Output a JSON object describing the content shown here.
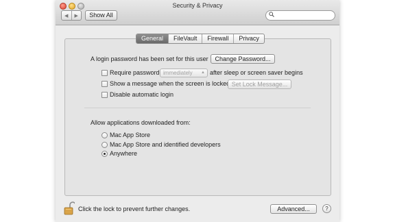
{
  "window": {
    "title": "Security & Privacy",
    "show_all_label": "Show All",
    "search_placeholder": ""
  },
  "tabs": [
    {
      "label": "General",
      "active": true
    },
    {
      "label": "FileVault",
      "active": false
    },
    {
      "label": "Firewall",
      "active": false
    },
    {
      "label": "Privacy",
      "active": false
    }
  ],
  "general": {
    "login_password_text": "A login password has been set for this user",
    "change_password_label": "Change Password...",
    "require_password_label": "Require password",
    "require_password_value": "immediately",
    "require_password_suffix": "after sleep or screen saver begins",
    "show_message_label": "Show a message when the screen is locked",
    "set_lock_message_label": "Set Lock Message...",
    "disable_auto_login_label": "Disable automatic login"
  },
  "downloads": {
    "heading": "Allow applications downloaded from:",
    "options": [
      {
        "label": "Mac App Store",
        "selected": false
      },
      {
        "label": "Mac App Store and identified developers",
        "selected": false
      },
      {
        "label": "Anywhere",
        "selected": true
      }
    ]
  },
  "footer": {
    "lock_text": "Click the lock to prevent further changes.",
    "advanced_label": "Advanced...",
    "help_label": "?"
  },
  "icons": [
    "back-icon",
    "forward-icon",
    "search-icon",
    "lock-icon",
    "help-icon"
  ],
  "colors": {
    "active_tab": "#7a7a7a",
    "close": "#d8412f",
    "minimize": "#e0a323",
    "zoom": "#a6a6a6"
  }
}
